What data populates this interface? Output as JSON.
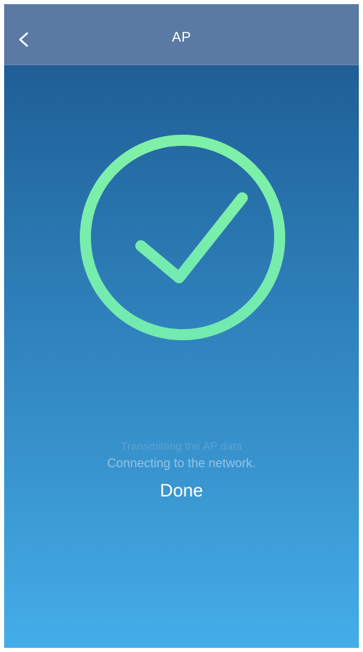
{
  "header": {
    "title": "AP",
    "back_icon": "chevron-left-icon"
  },
  "success": {
    "icon": "check-circle-icon",
    "color": "#7ff0a8"
  },
  "status": {
    "transmitting": "Transmitting the AP data",
    "connecting": "Connecting to the network.",
    "done": "Done"
  }
}
